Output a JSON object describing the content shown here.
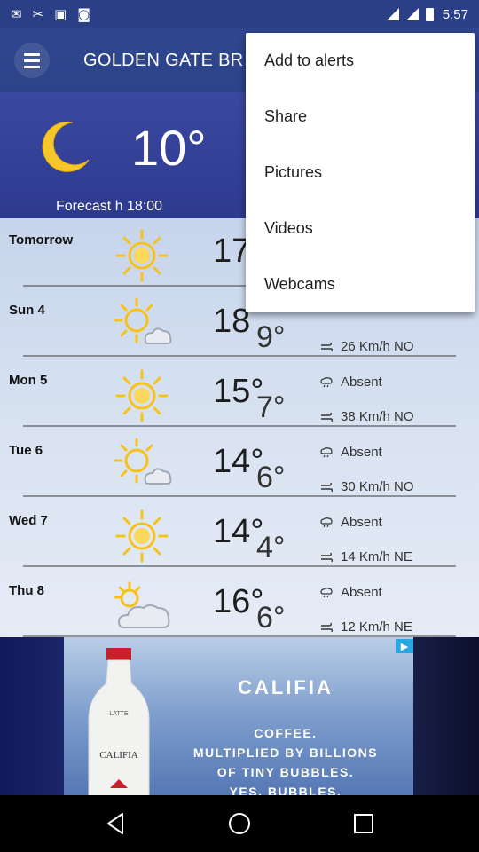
{
  "status_bar": {
    "time": "5:57",
    "left_icons": [
      "gmail-icon",
      "tools-icon",
      "store-icon",
      "notification-icon"
    ]
  },
  "header": {
    "title": "GOLDEN GATE BR",
    "menu_icon": "hamburger-icon"
  },
  "current": {
    "temperature": "10°",
    "icon": "moon-icon",
    "forecast_time": "Forecast h 18:00"
  },
  "forecast": [
    {
      "day": "Tomorrow",
      "tmax": "17",
      "tmin": "",
      "icon": "sun-icon",
      "precip": "",
      "wind": ""
    },
    {
      "day": "Sun 4",
      "tmax": "18",
      "tmin": "9°",
      "icon": "sun-cloud-icon",
      "precip": "",
      "wind": "26 Km/h NO"
    },
    {
      "day": "Mon 5",
      "tmax": "15°",
      "tmin": "7°",
      "icon": "sun-icon",
      "precip": "Absent",
      "wind": "38 Km/h NO"
    },
    {
      "day": "Tue 6",
      "tmax": "14°",
      "tmin": "6°",
      "icon": "sun-cloud-icon",
      "precip": "Absent",
      "wind": "30 Km/h NO"
    },
    {
      "day": "Wed 7",
      "tmax": "14°",
      "tmin": "4°",
      "icon": "sun-icon",
      "precip": "Absent",
      "wind": "14 Km/h NE"
    },
    {
      "day": "Thu 8",
      "tmax": "16°",
      "tmin": "6°",
      "icon": "cloud-sun-icon",
      "precip": "Absent",
      "wind": "12 Km/h NE"
    }
  ],
  "menu": {
    "items": [
      "Add to alerts",
      "Share",
      "Pictures",
      "Videos",
      "Webcams"
    ]
  },
  "ad": {
    "brand": "CALIFIA",
    "line1": "COFFEE.",
    "line2": "MULTIPLIED BY BILLIONS",
    "line3": "OF TINY BUBBLES.",
    "line4": "YES, BUBBLES.",
    "bottle_text": "CALIFIA",
    "bottle_label": "LATTE"
  },
  "colors": {
    "sun": "#f7c21a",
    "header": "#2f478f",
    "list_bg": "#d5e0f0"
  }
}
